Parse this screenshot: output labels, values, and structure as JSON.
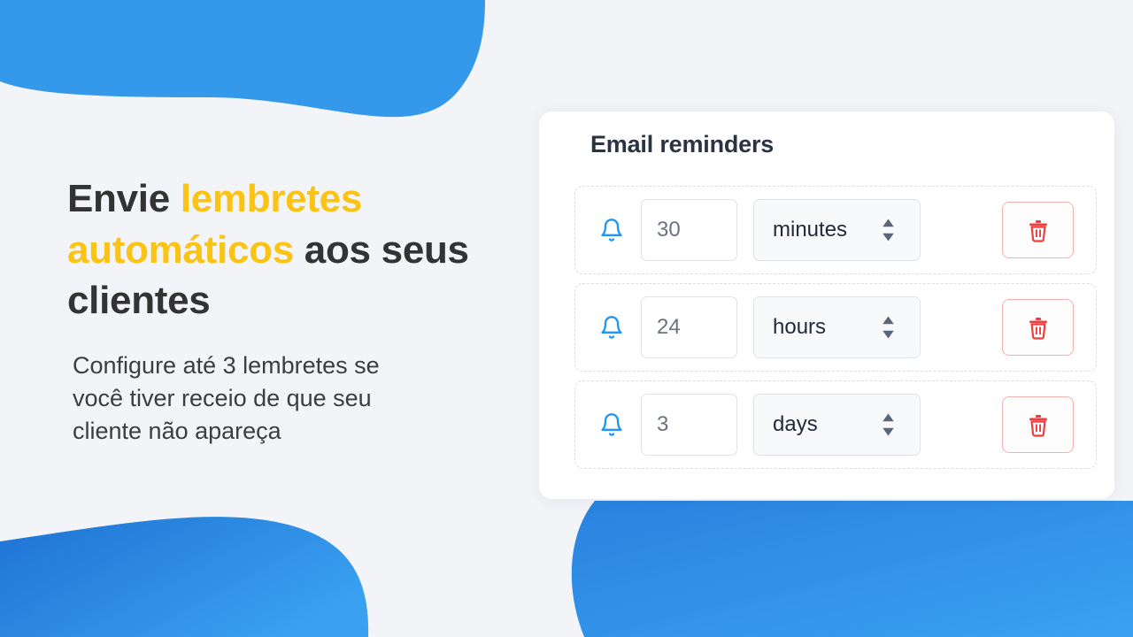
{
  "background": {
    "page_color": "#f3f4f7",
    "blob_blue": "#3498eb",
    "blob_blue_dark": "#1f72d4",
    "blob_blue_light": "#3aa0f0"
  },
  "hero": {
    "headline_parts": [
      {
        "text": "Envie ",
        "accent": false
      },
      {
        "text": "lembretes automáticos",
        "accent": true
      },
      {
        "text": " aos seus clientes",
        "accent": false
      }
    ],
    "headline_plain": "Envie lembretes automáticos aos seus clientes",
    "headline_lead": "Envie ",
    "headline_accent": "lembretes automáticos",
    "headline_tail": " aos seus clientes",
    "subtext": "Configure até 3 lembretes se você tiver receio de que seu cliente não apareça",
    "accent_color": "#fbc313",
    "text_color": "#333333"
  },
  "card": {
    "title": "Email reminders",
    "title_color": "#2a3342",
    "rows": [
      {
        "bell_icon": "bell-icon",
        "value": "30",
        "value_placeholder": "30",
        "unit": "minutes",
        "spinner_icon": "spinner-up-down-icon",
        "delete_icon": "trash-icon"
      },
      {
        "bell_icon": "bell-icon",
        "value": "24",
        "value_placeholder": "24",
        "unit": "hours",
        "spinner_icon": "spinner-up-down-icon",
        "delete_icon": "trash-icon"
      },
      {
        "bell_icon": "bell-icon",
        "value": "3",
        "value_placeholder": "3",
        "unit": "days",
        "spinner_icon": "spinner-up-down-icon",
        "delete_icon": "trash-icon"
      }
    ],
    "unit_options": [
      "minutes",
      "hours",
      "days"
    ],
    "bell_color": "#2196f3",
    "delete_color": "#f03e3e",
    "delete_border_color": "#f7b0b0"
  }
}
